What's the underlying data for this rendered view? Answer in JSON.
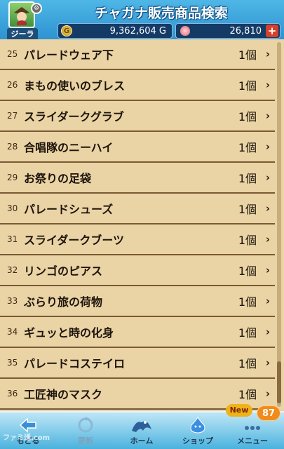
{
  "header": {
    "title": "チャガナ販売商品検索",
    "player_name": "ジーラ",
    "gold": "9,362,604 G",
    "gold_icon_label": "G",
    "gems": "26,810",
    "plus_label": "+"
  },
  "list": {
    "items": [
      {
        "num": "25",
        "name": "パレードウェア下",
        "qty": "1個"
      },
      {
        "num": "26",
        "name": "まもの使いのブレス",
        "qty": "1個"
      },
      {
        "num": "27",
        "name": "スライダークグラブ",
        "qty": "1個"
      },
      {
        "num": "28",
        "name": "合唱隊のニーハイ",
        "qty": "1個"
      },
      {
        "num": "29",
        "name": "お祭りの足袋",
        "qty": "1個"
      },
      {
        "num": "30",
        "name": "パレードシューズ",
        "qty": "1個"
      },
      {
        "num": "31",
        "name": "スライダークブーツ",
        "qty": "1個"
      },
      {
        "num": "32",
        "name": "リンゴのピアス",
        "qty": "1個"
      },
      {
        "num": "33",
        "name": "ぶらり旅の荷物",
        "qty": "1個"
      },
      {
        "num": "34",
        "name": "ギュッと時の化身",
        "qty": "1個"
      },
      {
        "num": "35",
        "name": "パレードコステイロ",
        "qty": "1個"
      },
      {
        "num": "36",
        "name": "工匠神のマスク",
        "qty": "1個"
      }
    ],
    "chevron": "›"
  },
  "nav": {
    "back": "もどる",
    "refresh": "更新",
    "home": "ホーム",
    "shop": "ショップ",
    "menu": "メニュー",
    "new_badge": "New",
    "menu_count": "87"
  },
  "watermark": "ファミ通.com",
  "colors": {
    "header_blue": "#2a8fd0",
    "parchment": "#ead3a4",
    "divider": "#7a5a34",
    "plus_red": "#d6402a",
    "badge_orange": "#f18c1c"
  }
}
